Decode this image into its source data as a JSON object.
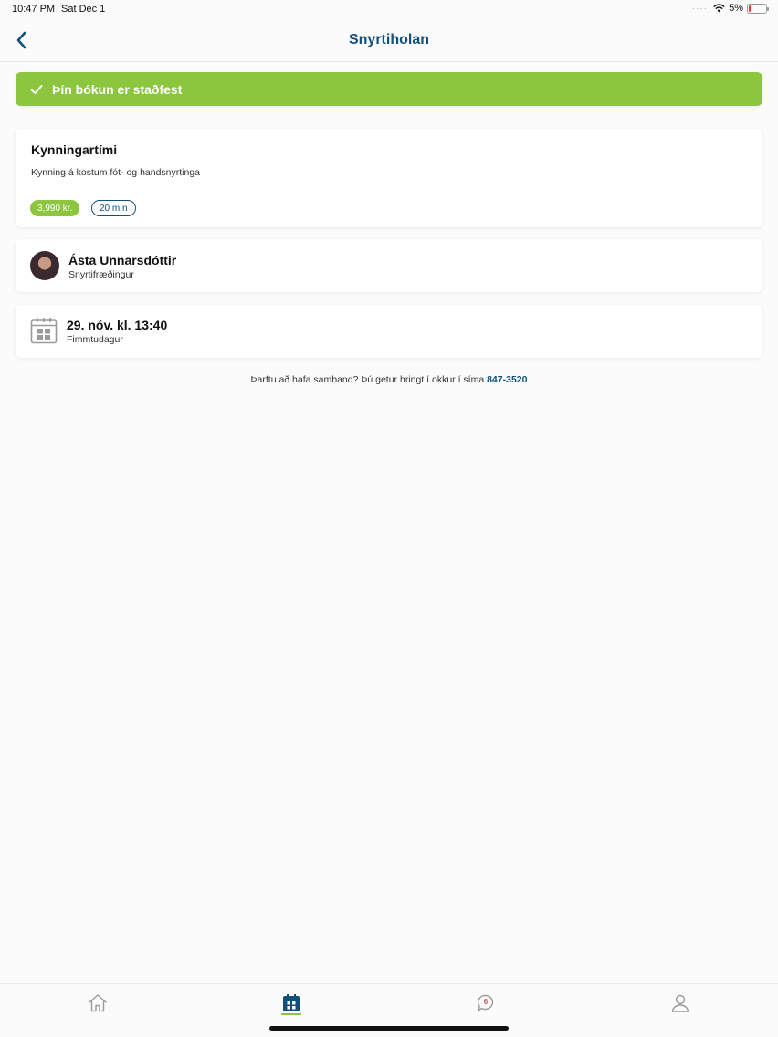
{
  "status_bar": {
    "time": "10:47 PM",
    "date": "Sat Dec 1",
    "battery": "5%",
    "battery_level": 0.05
  },
  "nav": {
    "title": "Snyrtiholan",
    "back_icon": "chevron-left-icon"
  },
  "banner": {
    "text": "Þín bókun er staðfest",
    "icon": "check-icon",
    "color": "#8cc63f"
  },
  "service": {
    "title": "Kynningartími",
    "description": "Kynning á kostum fót- og handsnyrtinga",
    "price": "3,990 kr.",
    "duration": "20 mín"
  },
  "staff": {
    "name": "Ásta Unnarsdóttir",
    "role": "Snyrtifræðingur"
  },
  "appointment": {
    "datetime": "29. nóv. kl. 13:40",
    "weekday": "Fimmtudagur",
    "icon": "calendar-icon"
  },
  "contact": {
    "text": "Þarftu að hafa samband? Þú getur hringt í okkur í síma",
    "phone": "847-3520"
  },
  "tab_bar": {
    "tabs": [
      {
        "name": "home",
        "icon": "home-icon"
      },
      {
        "name": "bookings",
        "icon": "calendar-icon",
        "active": true
      },
      {
        "name": "messages",
        "icon": "chat-bubble-icon",
        "badge": "6"
      },
      {
        "name": "profile",
        "icon": "person-icon"
      }
    ]
  },
  "colors": {
    "brand_blue": "#12507a",
    "accent_green": "#8cc63f",
    "badge_red": "#d9534f"
  }
}
